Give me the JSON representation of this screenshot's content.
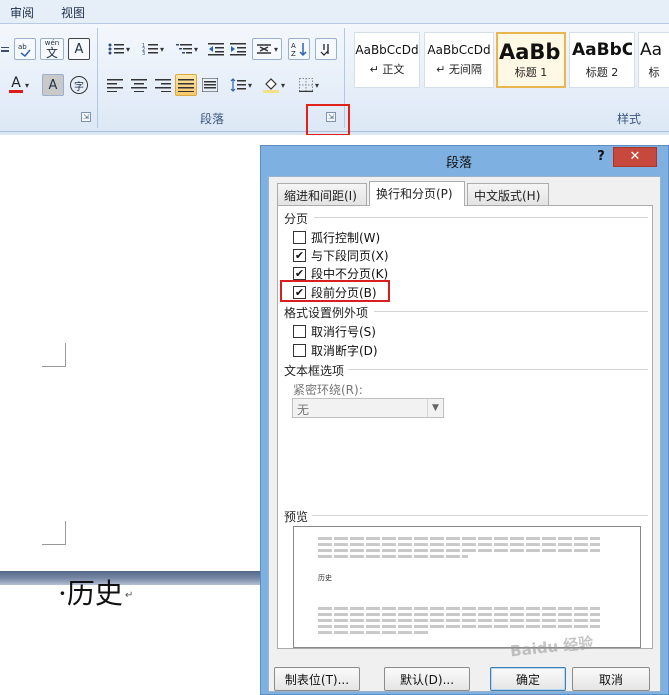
{
  "menubar": {
    "tabs": [
      "审阅",
      "视图"
    ]
  },
  "ribbon": {
    "groups": {
      "paragraph": "段落",
      "styles": "样式"
    },
    "styles": [
      {
        "sample": "AaBbCcDd",
        "name": "↵ 正文"
      },
      {
        "sample": "AaBbCcDd",
        "name": "↵ 无间隔"
      },
      {
        "sample": "AaBb",
        "name": "标题 1"
      },
      {
        "sample": "AaBbC",
        "name": "标题 2"
      },
      {
        "sample": "Aa",
        "name": "标"
      }
    ],
    "glyphs": {
      "phonetic": "wén",
      "wen": "文",
      "font_a": "A",
      "enclose": "字"
    }
  },
  "document": {
    "text": "·历史",
    "pilcrow": "↵"
  },
  "dialog": {
    "title": "段落",
    "help": "?",
    "close": "✕",
    "tabs": [
      "缩进和间距(I)",
      "换行和分页(P)",
      "中文版式(H)"
    ],
    "pagination": {
      "label": "分页",
      "options": [
        {
          "label": "孤行控制(W)",
          "checked": false
        },
        {
          "label": "与下段同页(X)",
          "checked": true
        },
        {
          "label": "段中不分页(K)",
          "checked": true
        },
        {
          "label": "段前分页(B)",
          "checked": true
        }
      ]
    },
    "exceptions": {
      "label": "格式设置例外项",
      "options": [
        {
          "label": "取消行号(S)",
          "checked": false
        },
        {
          "label": "取消断字(D)",
          "checked": false
        }
      ]
    },
    "textbox": {
      "label": "文本框选项",
      "wrap_label": "紧密环绕(R):",
      "wrap_value": "无"
    },
    "preview": {
      "label": "预览",
      "sample": "历史"
    },
    "buttons": {
      "tabs": "制表位(T)...",
      "default": "默认(D)...",
      "ok": "确定",
      "cancel": "取消"
    }
  },
  "watermark": "Baidu 经验"
}
